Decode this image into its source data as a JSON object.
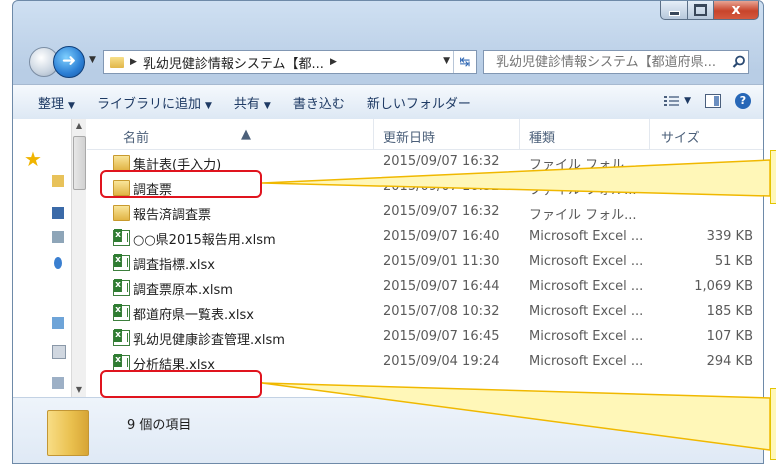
{
  "window": {
    "minimize_icon": "minimize-icon",
    "maximize_icon": "maximize-icon",
    "close_glyph": "x"
  },
  "address": {
    "path": "乳幼児健診情報システム【都...",
    "search_placeholder": "乳幼児健診情報システム【都道府県..."
  },
  "toolbar": {
    "organize": "整理",
    "add_to_library": "ライブラリに追加",
    "share": "共有",
    "burn": "書き込む",
    "new_folder": "新しいフォルダー"
  },
  "columns": {
    "name": "名前",
    "date": "更新日時",
    "type": "種類",
    "size": "サイズ"
  },
  "files": [
    {
      "icon": "folder",
      "name": "集計表(手入力)",
      "date": "2015/09/07 16:32",
      "type": "ファイル フォル...",
      "size": ""
    },
    {
      "icon": "folder",
      "name": "調査票",
      "date": "2015/09/07 16:32",
      "type": "ファイル フォル...",
      "size": ""
    },
    {
      "icon": "folder",
      "name": "報告済調査票",
      "date": "2015/09/07 16:32",
      "type": "ファイル フォル...",
      "size": ""
    },
    {
      "icon": "excel",
      "name": "○○県2015報告用.xlsm",
      "date": "2015/09/07 16:40",
      "type": "Microsoft Excel ...",
      "size": "339 KB"
    },
    {
      "icon": "excel",
      "name": "調査指標.xlsx",
      "date": "2015/09/01 11:30",
      "type": "Microsoft Excel ...",
      "size": "51 KB"
    },
    {
      "icon": "excel",
      "name": "調査票原本.xlsm",
      "date": "2015/09/07 16:44",
      "type": "Microsoft Excel ...",
      "size": "1,069 KB"
    },
    {
      "icon": "excel",
      "name": "都道府県一覧表.xlsx",
      "date": "2015/07/08 10:32",
      "type": "Microsoft Excel ...",
      "size": "185 KB"
    },
    {
      "icon": "excel",
      "name": "乳幼児健康診査管理.xlsm",
      "date": "2015/09/07 16:45",
      "type": "Microsoft Excel ...",
      "size": "107 KB"
    },
    {
      "icon": "excel",
      "name": "分析結果.xlsx",
      "date": "2015/09/04 19:24",
      "type": "Microsoft Excel ...",
      "size": "294 KB"
    }
  ],
  "status": {
    "item_count": "9 個の項目"
  },
  "colors": {
    "highlight_border": "#e0141e",
    "callout_line": "#f0b800",
    "callout_fill": "#fff7b8"
  }
}
